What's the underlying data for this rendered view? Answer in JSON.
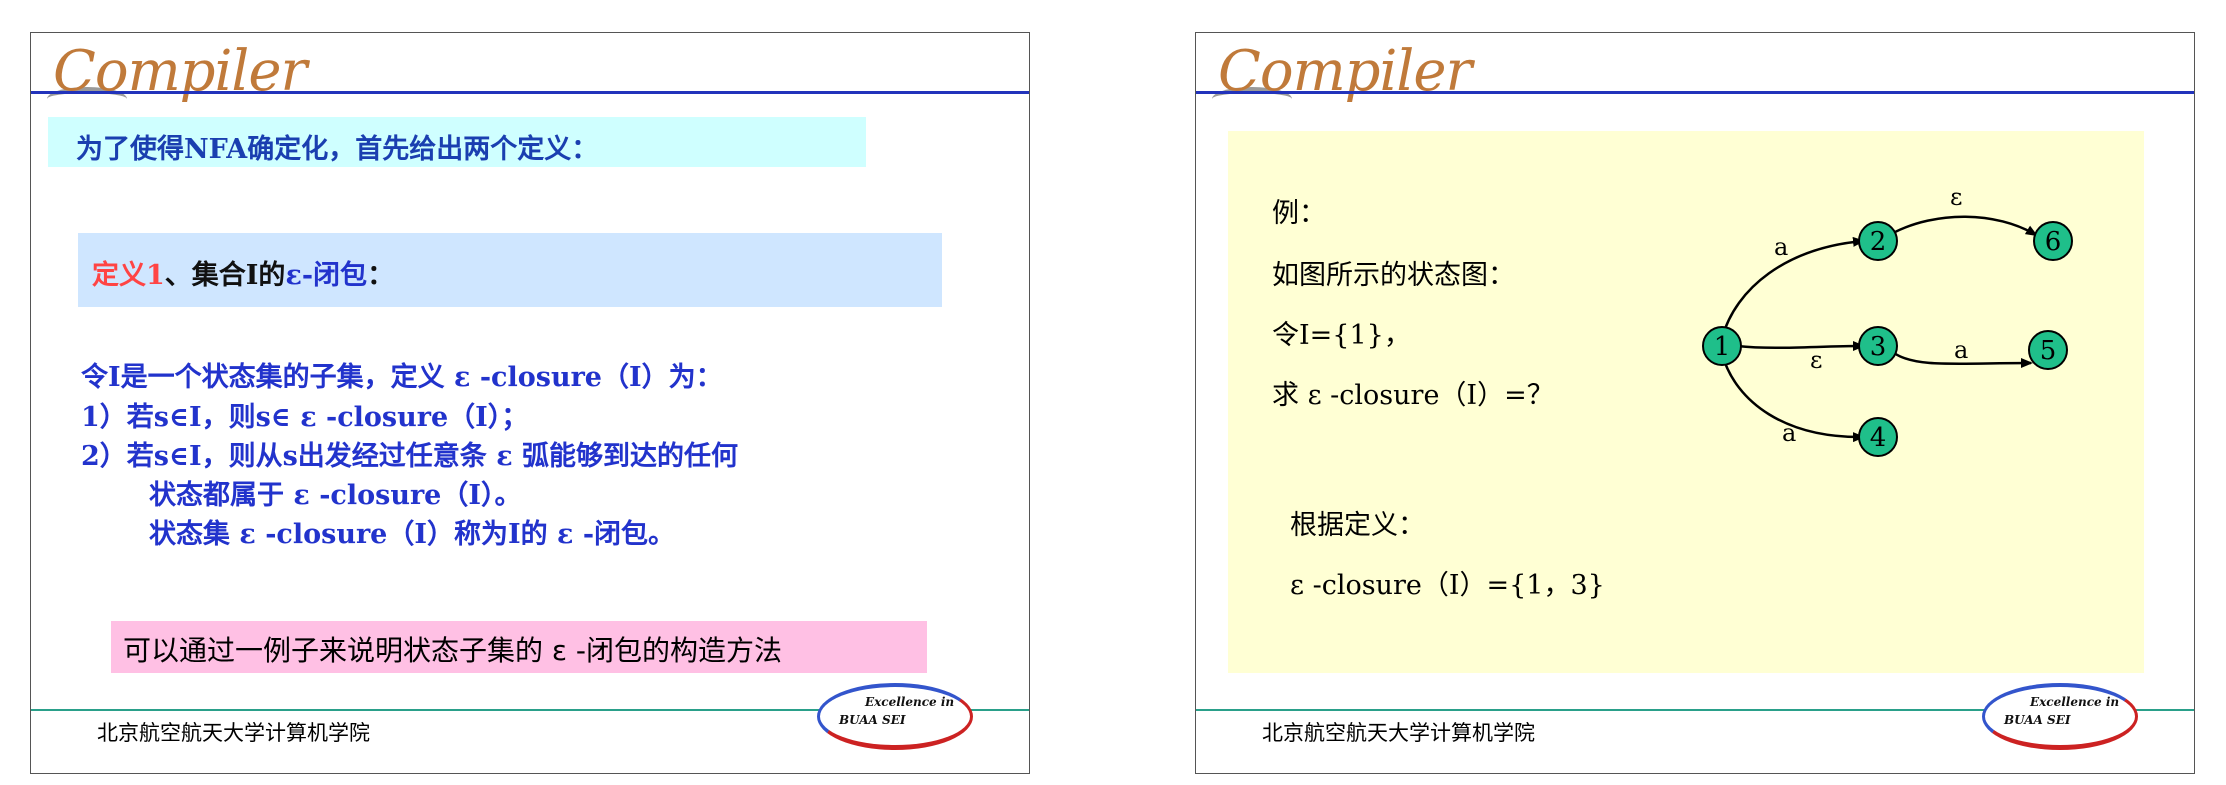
{
  "slide1": {
    "logo_text": "Compiler",
    "title": "为了使得NFA确定化，首先给出两个定义：",
    "definition": {
      "prefix": "定义1",
      "middle": "、集合I的",
      "term": "ε-闭包",
      "suffix": "："
    },
    "body_lines": [
      "令I是一个状态集的子集，定义 ε -closure（I）为：",
      "1）若s∈I，则s∈ ε -closure（I）；",
      "2）若s∈I，则从s出发经过任意条 ε 弧能够到达的任何",
      "状态都属于 ε -closure（I）。",
      "状态集 ε -closure（I）称为I的 ε -闭包。"
    ],
    "note": "可以通过一例子来说明状态子集的 ε -闭包的构造方法",
    "footer": "北京航空航天大学计算机学院",
    "badge": {
      "line1": "Excellence in",
      "line2": "BUAA  SEI"
    }
  },
  "slide2": {
    "logo_text": "Compiler",
    "lines": [
      "例：",
      "如图所示的状态图：",
      "令I={1}，",
      "求 ε -closure（I）=？"
    ],
    "conclusion_label": "根据定义：",
    "conclusion": "ε -closure（I）={1，3}",
    "footer": "北京航空航天大学计算机学院",
    "badge": {
      "line1": "Excellence in",
      "line2": "BUAA  SEI"
    },
    "diagram": {
      "node_color": "#1fbf8a",
      "nodes": [
        "1",
        "2",
        "3",
        "4",
        "5",
        "6"
      ],
      "edge_labels": {
        "e12": "a",
        "e13": "ε",
        "e14": "a",
        "e26": "ε",
        "e35": "a"
      }
    }
  }
}
